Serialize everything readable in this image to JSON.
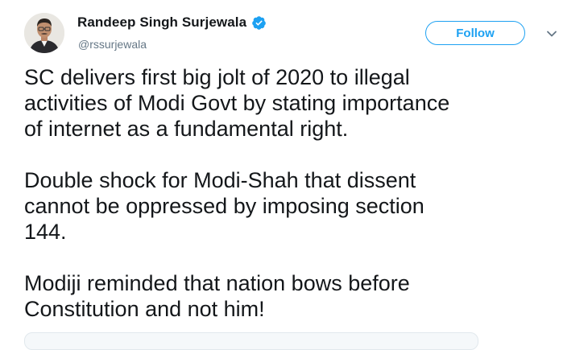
{
  "author": {
    "display_name": "Randeep Singh Surjewala",
    "handle": "@rssurjewala",
    "verified": true,
    "avatar_icon": "profile-photo"
  },
  "actions": {
    "follow_label": "Follow",
    "menu_icon": "chevron-down-icon"
  },
  "tweet": {
    "paragraphs": [
      "SC delivers first big jolt of 2020 to illegal\nactivities of Modi Govt by stating importance\nof internet as a fundamental right.",
      "Double shock for Modi-Shah that dissent\ncannot be oppressed by imposing section\n144.",
      "Modiji reminded that nation bows before\nConstitution and not him!"
    ]
  },
  "colors": {
    "accent": "#1da1f2",
    "text": "#14171a",
    "secondary_text": "#657786",
    "verified_badge": "#1da1f2"
  }
}
